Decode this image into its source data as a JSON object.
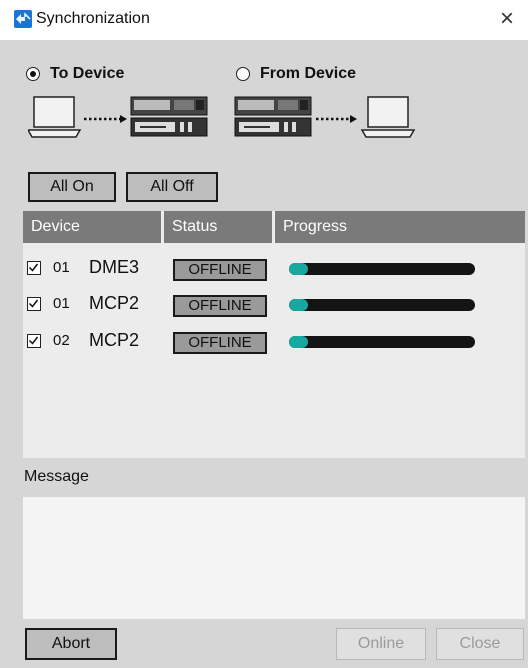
{
  "window": {
    "title": "Synchronization",
    "close_label": "×"
  },
  "direction": {
    "to_device": {
      "label": "To Device",
      "selected": true
    },
    "from_device": {
      "label": "From Device",
      "selected": false
    }
  },
  "toggle_buttons": {
    "all_on": "All On",
    "all_off": "All Off"
  },
  "table": {
    "headers": {
      "device": "Device",
      "status": "Status",
      "progress": "Progress"
    },
    "rows": [
      {
        "checked": true,
        "number": "01",
        "name": "DME3",
        "status": "OFFLINE",
        "progress_fraction": 0.1
      },
      {
        "checked": true,
        "number": "01",
        "name": "MCP2",
        "status": "OFFLINE",
        "progress_fraction": 0.1
      },
      {
        "checked": true,
        "number": "02",
        "name": "MCP2",
        "status": "OFFLINE",
        "progress_fraction": 0.1
      }
    ]
  },
  "message": {
    "label": "Message",
    "text": ""
  },
  "footer": {
    "abort": "Abort",
    "online": "Online",
    "close": "Close"
  },
  "colors": {
    "progress_fill": "#17a8a0",
    "progress_track": "#141414",
    "header_bg": "#7a7a7a",
    "app_icon": "#1e73d6"
  }
}
